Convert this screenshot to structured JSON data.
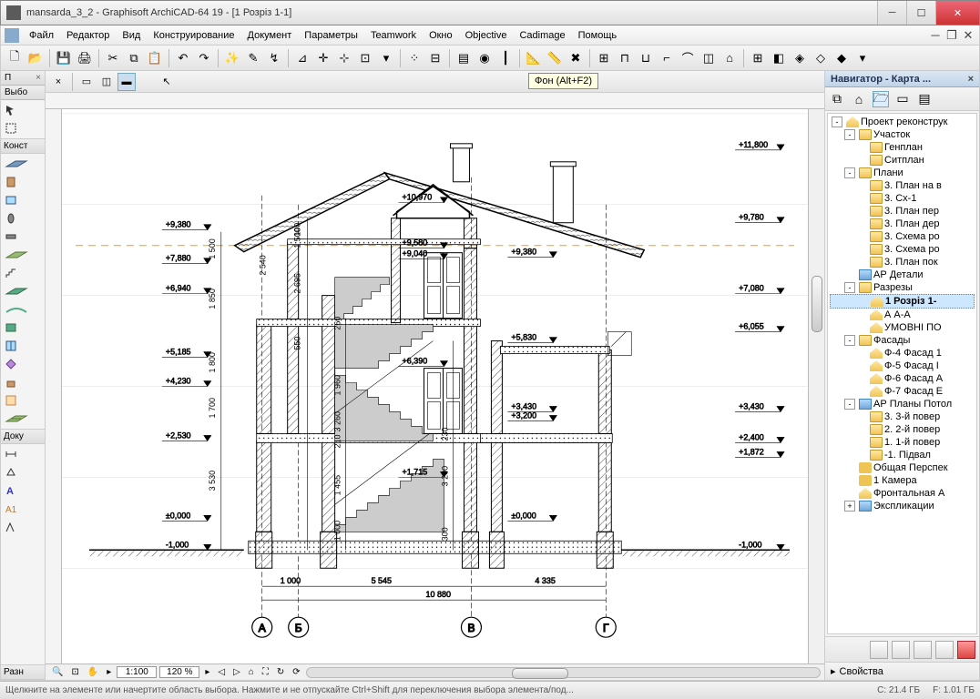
{
  "window": {
    "title": "mansarda_3_2 - Graphisoft ArchiCAD-64 19 - [1 Розріз 1-1]"
  },
  "menu": {
    "items": [
      "Файл",
      "Редактор",
      "Вид",
      "Конструирование",
      "Документ",
      "Параметры",
      "Teamwork",
      "Окно",
      "Objective",
      "Cadimage",
      "Помощь"
    ]
  },
  "tooltip": "Фон (Alt+F2)",
  "left": {
    "hdr1": "П",
    "hdr2": "Выбо",
    "group_const": "Конст",
    "group_doc": "Доку",
    "group_razn": "Разн"
  },
  "navigator": {
    "title": "Навигатор - Карта ...",
    "root": "Проект реконструк",
    "tree": [
      {
        "ind": 1,
        "tog": "-",
        "ico": "folder",
        "txt": "Участок"
      },
      {
        "ind": 2,
        "tog": "",
        "ico": "folder",
        "txt": "Генплан"
      },
      {
        "ind": 2,
        "tog": "",
        "ico": "folder",
        "txt": "Ситплан"
      },
      {
        "ind": 1,
        "tog": "-",
        "ico": "folder",
        "txt": "Плани"
      },
      {
        "ind": 2,
        "tog": "",
        "ico": "folder",
        "txt": "3. План на в"
      },
      {
        "ind": 2,
        "tog": "",
        "ico": "folder",
        "txt": "3. Сх-1"
      },
      {
        "ind": 2,
        "tog": "",
        "ico": "folder",
        "txt": "3. План пер"
      },
      {
        "ind": 2,
        "tog": "",
        "ico": "folder",
        "txt": "3. План дер"
      },
      {
        "ind": 2,
        "tog": "",
        "ico": "folder",
        "txt": "3. Схема ро"
      },
      {
        "ind": 2,
        "tog": "",
        "ico": "folder",
        "txt": "3. Схема ро"
      },
      {
        "ind": 2,
        "tog": "",
        "ico": "folder",
        "txt": "3. План пок"
      },
      {
        "ind": 1,
        "tog": "",
        "ico": "blue",
        "txt": "АР Детали"
      },
      {
        "ind": 1,
        "tog": "-",
        "ico": "folder",
        "txt": "Разрезы"
      },
      {
        "ind": 2,
        "tog": "",
        "ico": "house",
        "txt": "1 Розріз 1-",
        "sel": true
      },
      {
        "ind": 2,
        "tog": "",
        "ico": "house",
        "txt": "А А-А"
      },
      {
        "ind": 2,
        "tog": "",
        "ico": "house",
        "txt": "УМОВНІ ПО"
      },
      {
        "ind": 1,
        "tog": "-",
        "ico": "folder",
        "txt": "Фасады"
      },
      {
        "ind": 2,
        "tog": "",
        "ico": "house",
        "txt": "Ф-4 Фасад 1"
      },
      {
        "ind": 2,
        "tog": "",
        "ico": "house",
        "txt": "Ф-5 Фасад I"
      },
      {
        "ind": 2,
        "tog": "",
        "ico": "house",
        "txt": "Ф-6 Фасад А"
      },
      {
        "ind": 2,
        "tog": "",
        "ico": "house",
        "txt": "Ф-7 Фасад Е"
      },
      {
        "ind": 1,
        "tog": "-",
        "ico": "blue",
        "txt": "АР Планы Потол"
      },
      {
        "ind": 2,
        "tog": "",
        "ico": "folder",
        "txt": "3. 3-й повер"
      },
      {
        "ind": 2,
        "tog": "",
        "ico": "folder",
        "txt": "2. 2-й повер"
      },
      {
        "ind": 2,
        "tog": "",
        "ico": "folder",
        "txt": "1. 1-й повер"
      },
      {
        "ind": 2,
        "tog": "",
        "ico": "folder",
        "txt": "-1. Підвал"
      },
      {
        "ind": 1,
        "tog": "",
        "ico": "cam",
        "txt": "Общая Перспек"
      },
      {
        "ind": 1,
        "tog": "",
        "ico": "cam",
        "txt": "1 Камера"
      },
      {
        "ind": 1,
        "tog": "",
        "ico": "house",
        "txt": "Фронтальная А"
      },
      {
        "ind": 1,
        "tog": "+",
        "ico": "blue",
        "txt": "Экспликации"
      }
    ],
    "props": "Свойства"
  },
  "viewbar": {
    "scale": "1:100",
    "zoom": "120 %"
  },
  "status": {
    "hint": "Щелкните на элементе или начертите область выбора. Нажмите и не отпускайте Ctrl+Shift для переключения выбора элемента/под...",
    "c": "C: 21.4 ГБ",
    "f": "F: 1.01 ГБ"
  },
  "elevations": {
    "left": [
      "+9,380",
      "+7,880",
      "+6,940",
      "+5,185",
      "+4,230",
      "+2,530",
      "±0,000",
      "-1,000"
    ],
    "right_near": [
      "+9,380",
      "+5,830",
      "+3,430",
      "+3,200",
      "±0,000"
    ],
    "right_far": [
      "+11,800",
      "+9,780",
      "+7,080",
      "+6,055",
      "+3,430",
      "+2,400",
      "+1,872",
      "-1,000"
    ],
    "inner": [
      "+10,970",
      "+9,580",
      "+9,040",
      "+6,390",
      "+1,715"
    ]
  },
  "vdims": [
    "1 500",
    "1 850",
    "1 800",
    "1 700",
    "3 530",
    "1 500",
    "100",
    "2 540",
    "2 695",
    "260",
    "550",
    "1 960",
    "3 260",
    "210",
    "230",
    "1 455",
    "1 000",
    "3 200",
    "300"
  ],
  "hdims": {
    "seg": [
      "1 000",
      "5 545",
      "4 335"
    ],
    "total": "10 880"
  },
  "axes": [
    "А",
    "Б",
    "В",
    "Г"
  ]
}
